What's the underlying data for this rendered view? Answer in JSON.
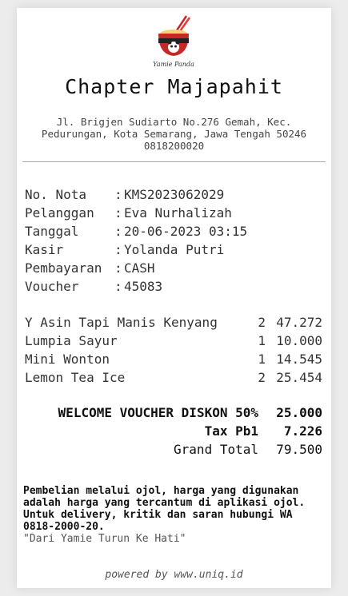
{
  "store": {
    "logo_text": "Yamie Panda",
    "name": "Chapter Majapahit",
    "address": "Jl. Brigjen Sudiarto No.276 Gemah, Kec. Pedurungan, Kota Semarang, Jawa Tengah 50246",
    "phone": "0818200020"
  },
  "info": [
    {
      "label": "No. Nota",
      "value": "KMS2023062029"
    },
    {
      "label": "Pelanggan",
      "value": "Eva Nurhalizah"
    },
    {
      "label": "Tanggal",
      "value": "20-06-2023 03:15"
    },
    {
      "label": "Kasir",
      "value": "Yolanda Putri"
    },
    {
      "label": "Pembayaran",
      "value": "CASH"
    },
    {
      "label": "Voucher",
      "value": "45083"
    }
  ],
  "separator": ":",
  "items": [
    {
      "name": "Y Asin Tapi Manis Kenyang",
      "qty": "2",
      "price": "47.272"
    },
    {
      "name": "Lumpia Sayur",
      "qty": "1",
      "price": "10.000"
    },
    {
      "name": "Mini Wonton",
      "qty": "1",
      "price": "14.545"
    },
    {
      "name": "Lemon Tea Ice",
      "qty": "2",
      "price": "25.454"
    }
  ],
  "totals": [
    {
      "label": "WELCOME VOUCHER DISKON 50%",
      "value": "25.000"
    },
    {
      "label": "Tax Pb1",
      "value": "7.226"
    },
    {
      "label": "Grand Total",
      "value": "79.500"
    }
  ],
  "note": "Pembelian melalui ojol, harga yang digunakan adalah harga yang tercantum di aplikasi ojol. Untuk delivery, kritik dan saran hubungi WA 0818-2000-20.",
  "tagline": "\"Dari Yamie Turun Ke Hati\"",
  "footer": "powered by www.uniq.id"
}
